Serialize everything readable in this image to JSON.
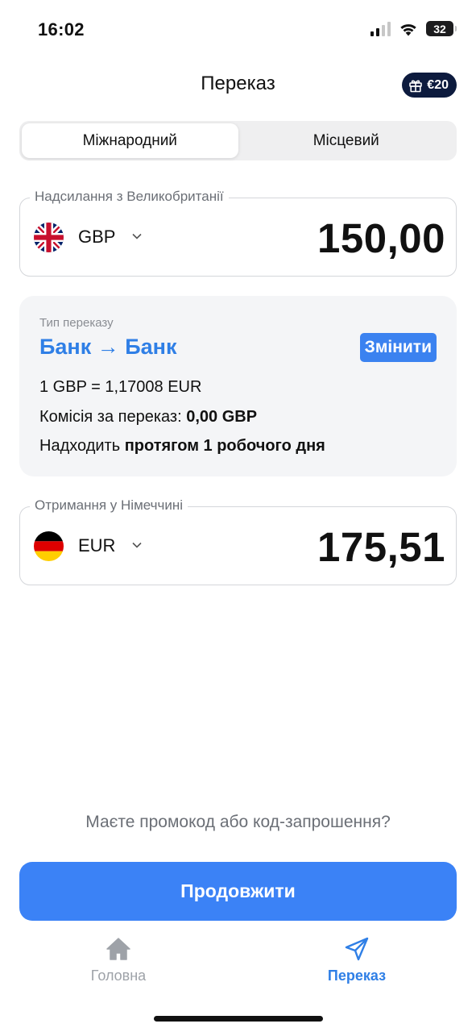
{
  "status_bar": {
    "time": "16:02",
    "battery": "32"
  },
  "header": {
    "title": "Переказ",
    "gift_badge": "€20"
  },
  "segmented": {
    "international": "Міжнародний",
    "local": "Місцевий",
    "active": "international"
  },
  "send": {
    "legend": "Надсилання з Великобританії",
    "currency": "GBP",
    "amount": "150,00"
  },
  "info": {
    "label": "Тип переказу",
    "type": "Банк → Банк",
    "change_label": "Змінити",
    "rate": "1 GBP = 1,17008 EUR",
    "fee_prefix": "Комісія за переказ: ",
    "fee_value": "0,00 GBP",
    "arrival_prefix": "Надходить ",
    "arrival_value": "протягом 1 робочого дня"
  },
  "receive": {
    "legend": "Отримання у Німеччині",
    "currency": "EUR",
    "amount": "175,51"
  },
  "promo": "Маєте промокод або код-запрошення?",
  "continue_label": "Продовжити",
  "tabs": {
    "home": "Головна",
    "transfer": "Переказ",
    "active": "transfer"
  },
  "colors": {
    "accent": "#3b82f6",
    "link": "#2f7fe6",
    "badge": "#0d1b3e"
  }
}
